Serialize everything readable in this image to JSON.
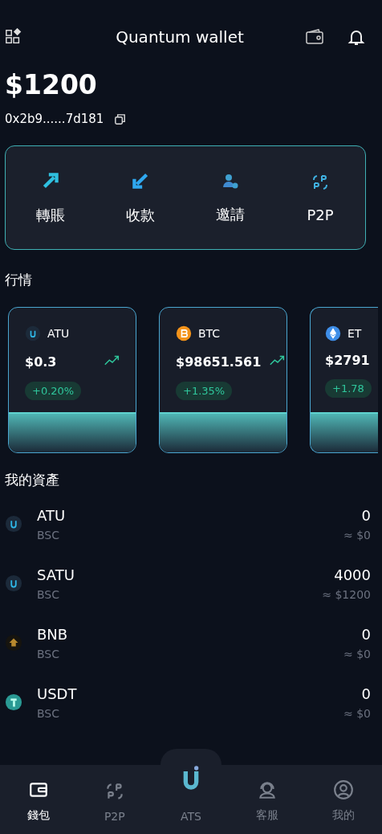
{
  "header": {
    "title": "Quantum wallet"
  },
  "balance": "$1200",
  "address": "0x2b9......7d181",
  "actions": [
    {
      "kind": "send",
      "label": "轉賬"
    },
    {
      "kind": "receive",
      "label": "收款"
    },
    {
      "kind": "invite",
      "label": "邀請"
    },
    {
      "kind": "p2p",
      "label": "P2P"
    }
  ],
  "market": {
    "title": "行情",
    "cards": [
      {
        "kind": "u",
        "symbol": "ATU",
        "price": "$0.3",
        "change": "+0.20%",
        "partial": false
      },
      {
        "kind": "btc",
        "symbol": "BTC",
        "price": "$98651.561",
        "change": "+1.35%",
        "partial": false
      },
      {
        "kind": "eth",
        "symbol": "ET",
        "price": "$2791",
        "change": "+1.78",
        "partial": true
      }
    ]
  },
  "assets": {
    "title": "我的資產",
    "rows": [
      {
        "kind": "u",
        "symbol": "ATU",
        "chain": "BSC",
        "amount": "0",
        "value": "≈ $0"
      },
      {
        "kind": "u",
        "symbol": "SATU",
        "chain": "BSC",
        "amount": "4000",
        "value": "≈ $1200"
      },
      {
        "kind": "bnb",
        "symbol": "BNB",
        "chain": "BSC",
        "amount": "0",
        "value": "≈ $0"
      },
      {
        "kind": "usdt",
        "symbol": "USDT",
        "chain": "BSC",
        "amount": "0",
        "value": "≈ $0"
      }
    ]
  },
  "nav": [
    {
      "kind": "wallet",
      "label": "錢包",
      "selected": true
    },
    {
      "kind": "p2p",
      "label": "P2P",
      "selected": false
    },
    {
      "kind": "center",
      "label": "ATS",
      "selected": false
    },
    {
      "kind": "support",
      "label": "客服",
      "selected": false
    },
    {
      "kind": "profile",
      "label": "我的",
      "selected": false
    }
  ]
}
